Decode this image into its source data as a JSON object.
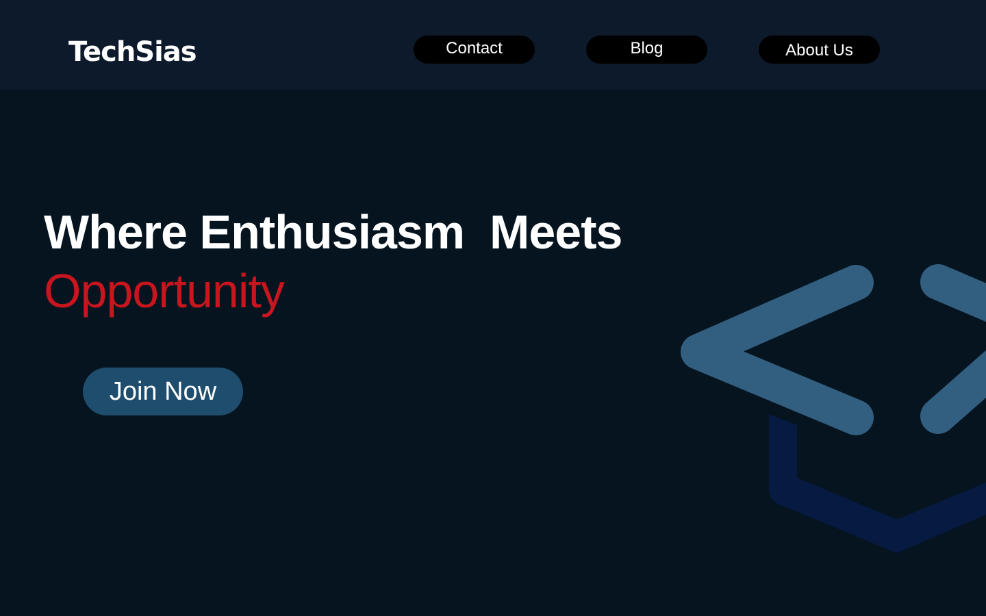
{
  "brand": {
    "name": "TechSias"
  },
  "nav": {
    "items": [
      {
        "label": "Contact"
      },
      {
        "label": "Blog"
      },
      {
        "label": "About Us"
      }
    ]
  },
  "hero": {
    "headline": "Where Enthusiasm  Meets",
    "headline_accent": "Opportunity",
    "cta_label": "Join Now"
  },
  "colors": {
    "background": "#05141f",
    "navbar": "#0d1a2b",
    "accent_red": "#c8151e",
    "button_blue": "#1e4d6e",
    "code_icon": "#325f80",
    "cap_icon": "#061a42"
  },
  "icons": {
    "decoration": "code-brackets-graduation-icon"
  }
}
